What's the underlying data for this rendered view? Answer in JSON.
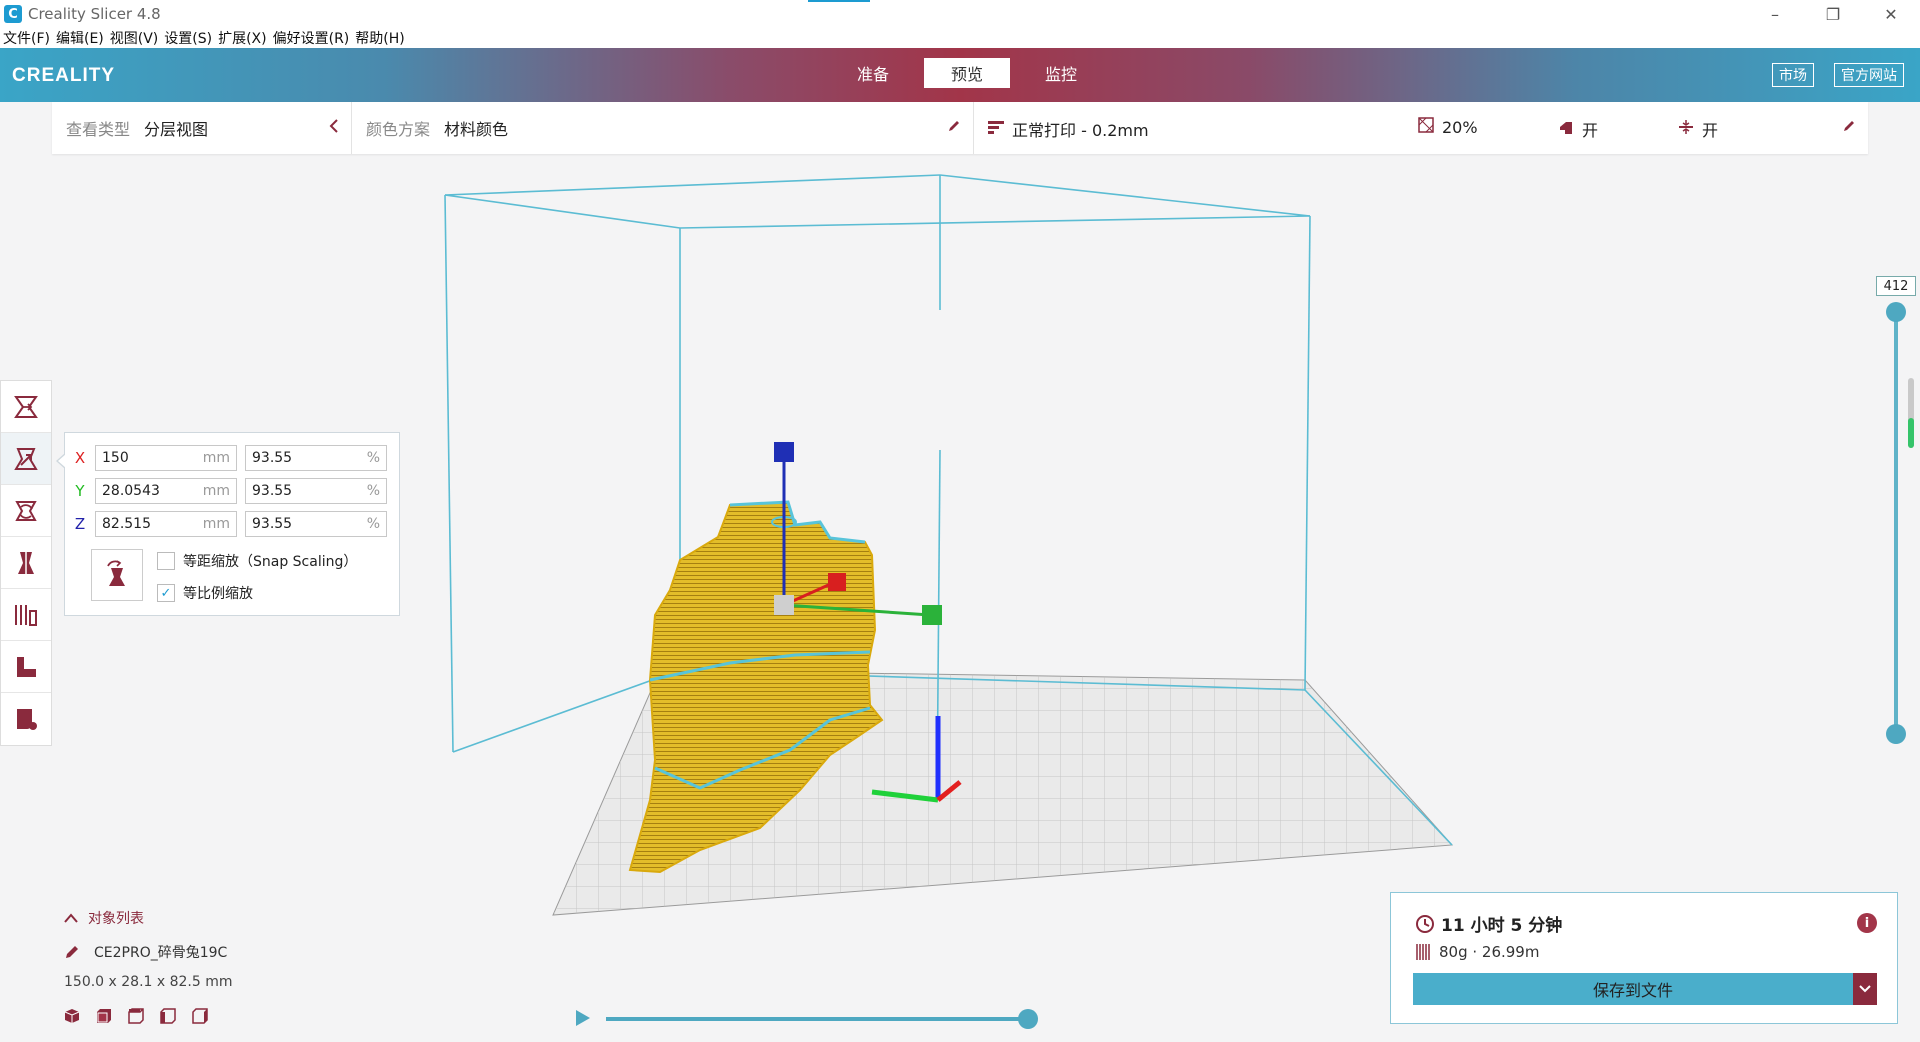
{
  "window": {
    "title": "Creality Slicer 4.8",
    "app_icon_letter": "C",
    "minimize": "–",
    "restore": "❐",
    "close": "✕"
  },
  "menu": [
    "文件(F)",
    "编辑(E)",
    "视图(V)",
    "设置(S)",
    "扩展(X)",
    "偏好设置(R)",
    "帮助(H)"
  ],
  "header": {
    "logo": "CREALITY",
    "tabs": [
      {
        "label": "准备"
      },
      {
        "label": "预览",
        "active": true
      },
      {
        "label": "监控"
      }
    ],
    "market_button": "市场",
    "website_button": "官方网站",
    "colors": {
      "accent": "#a23549",
      "primary": "#4aaecb"
    }
  },
  "toolbar": {
    "view_type_label": "查看类型",
    "view_type_value": "分层视图",
    "color_scheme_label": "颜色方案",
    "color_scheme_value": "材料颜色",
    "profile": "正常打印 - 0.2mm",
    "infill": "20%",
    "support": "开",
    "adhesion": "开"
  },
  "tools": [
    "move-tool",
    "scale-tool",
    "rotate-tool",
    "mirror-tool",
    "per-model-settings-tool",
    "support-blocker-tool",
    "custom-support-tool"
  ],
  "scale_panel": {
    "x": {
      "label": "X",
      "value": "150",
      "unit": "mm",
      "pct": "93.55",
      "pct_unit": "%"
    },
    "y": {
      "label": "Y",
      "value": "28.0543",
      "unit": "mm",
      "pct": "93.55",
      "pct_unit": "%"
    },
    "z": {
      "label": "Z",
      "value": "82.515",
      "unit": "mm",
      "pct": "93.55",
      "pct_unit": "%"
    },
    "snap_scaling_label": "等距缩放（Snap Scaling）",
    "snap_scaling_checked": false,
    "uniform_scaling_label": "等比例缩放",
    "uniform_scaling_checked": true
  },
  "layer_slider": {
    "current_layer": "412"
  },
  "object_list": {
    "header": "对象列表",
    "object_name": "CE2PRO_碎骨兔19C",
    "dimensions": "150.0 x 28.1 x 82.5 mm"
  },
  "result": {
    "print_time": "11 小时 5 分钟",
    "material": "80g · 26.99m",
    "save_button": "保存到文件",
    "info_icon": "i"
  }
}
